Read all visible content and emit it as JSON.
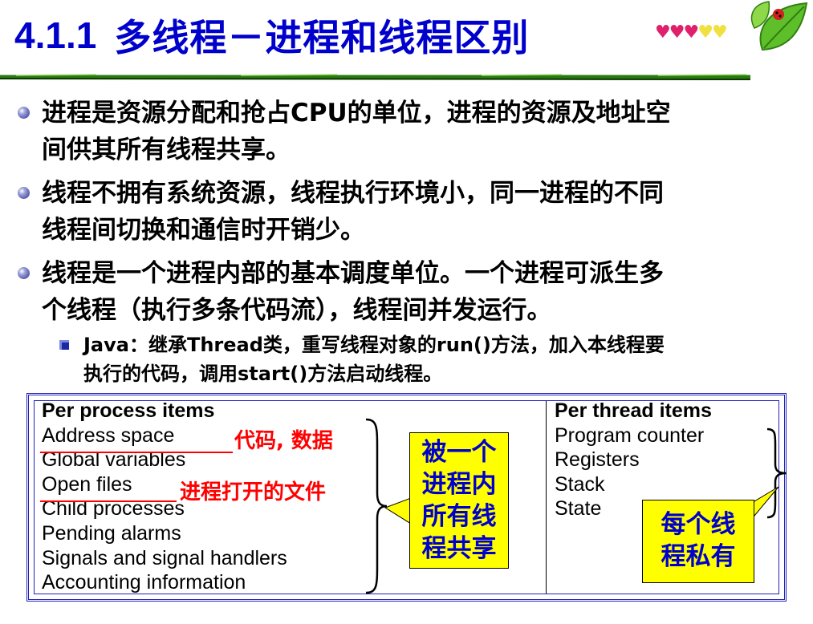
{
  "title": {
    "number": "4.1.1",
    "text": "多线程－进程和线程区别"
  },
  "icons": {
    "hearts": "heart-icons",
    "leaf": "leaf-ladybug-icon",
    "accent": "#0000cc"
  },
  "bullets": [
    {
      "line1": "进程是资源分配和抢占CPU的单位，进程的资源及地址空",
      "line2": "间供其所有线程共享。"
    },
    {
      "line1": "线程不拥有系统资源，线程执行环境小，同一进程的不同",
      "line2": "线程间切换和通信时开销少。"
    },
    {
      "line1": "线程是一个进程内部的基本调度单位。一个进程可派生多",
      "line2": "个线程（执行多条代码流），线程间并发运行。"
    }
  ],
  "sub_bullet": {
    "line1": "Java：继承Thread类，重写线程对象的run()方法，加入本线程要",
    "line2": "执行的代码，调用start()方法启动线程。"
  },
  "table": {
    "left_header": "Per process items",
    "left_items": [
      "Address space",
      "Global variables",
      "Open files",
      "Child processes",
      "Pending alarms",
      "Signals and signal handlers",
      "Accounting information"
    ],
    "right_header": "Per thread items",
    "right_items": [
      "Program counter",
      "Registers",
      "Stack",
      "State"
    ],
    "note_address": "代码, 数据",
    "note_files": "进程打开的文件",
    "callout_shared": [
      "被一个",
      "进程内",
      "所有线",
      "程共享"
    ],
    "callout_private": [
      "每个线",
      "程私有"
    ]
  }
}
